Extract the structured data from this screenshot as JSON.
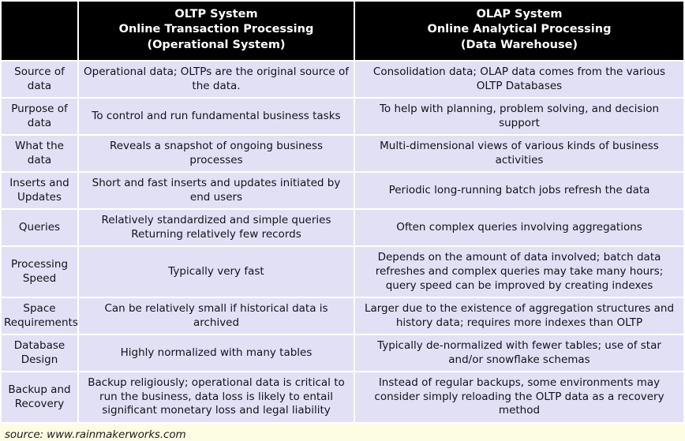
{
  "table": {
    "corner_label": "",
    "columns": [
      {
        "key": "label",
        "header_lines": []
      },
      {
        "key": "oltp",
        "header_lines": [
          "OLTP System",
          "Online Transaction Processing",
          "(Operational System)"
        ]
      },
      {
        "key": "olap",
        "header_lines": [
          "OLAP System",
          "Online Analytical Processing",
          "(Data Warehouse)"
        ]
      }
    ],
    "rows": [
      {
        "label": "Source of data",
        "oltp": "Operational data; OLTPs are the original source of the data.",
        "olap": "Consolidation data; OLAP data comes from the various OLTP Databases"
      },
      {
        "label": "Purpose of data",
        "oltp": "To control and run fundamental business tasks",
        "olap": "To help with planning, problem solving, and decision support"
      },
      {
        "label": "What the data",
        "oltp": "Reveals a snapshot of ongoing business processes",
        "olap": "Multi-dimensional views of various kinds of business activities"
      },
      {
        "label": "Inserts and Updates",
        "oltp": "Short and fast inserts and updates initiated by end users",
        "olap": "Periodic long-running batch jobs refresh the data"
      },
      {
        "label": "Queries",
        "oltp": "Relatively standardized and simple queries Returning relatively few records",
        "olap": "Often complex queries involving aggregations"
      },
      {
        "label": "Processing Speed",
        "oltp": "Typically very fast",
        "olap": "Depends on the amount of data involved; batch data refreshes and complex queries may take many hours; query speed can be improved by creating indexes"
      },
      {
        "label": "Space Requirements",
        "oltp": "Can be relatively small if historical data is archived",
        "olap": "Larger due to the existence of aggregation structures and history data; requires more indexes than OLTP"
      },
      {
        "label": "Database Design",
        "oltp": "Highly normalized with many tables",
        "olap": "Typically de-normalized with fewer tables; use of star and/or snowflake schemas"
      },
      {
        "label": "Backup and Recovery",
        "oltp": "Backup religiously; operational data is critical to run the business, data loss is likely to entail significant monetary loss and legal liability",
        "olap": "Instead of regular backups, some environments may consider simply reloading the OLTP data as a recovery method"
      }
    ]
  },
  "footer": {
    "source": "source: www.rainmakerworks.com"
  },
  "colors": {
    "header_background": "#000000",
    "header_text": "#ffffff",
    "cell_background": "#e2e0f5",
    "cell_text": "#12121c",
    "grid_line": "#ffffff",
    "footer_background": "#fdfde4"
  }
}
